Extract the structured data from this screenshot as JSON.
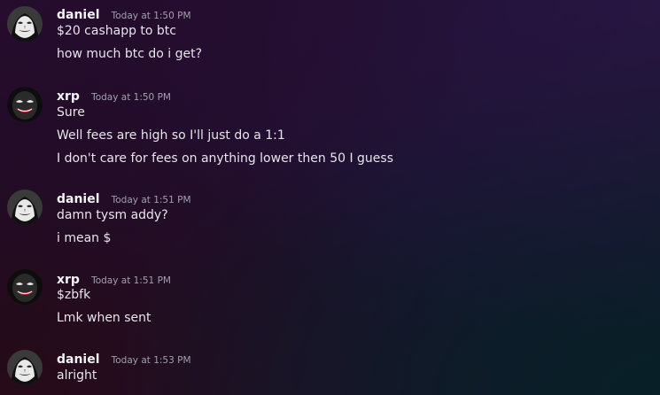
{
  "messages": [
    {
      "author": "daniel",
      "avatar_icon": "anonymous-mask-avatar-icon",
      "timestamp": "Today at 1:50 PM",
      "lines": [
        "$20 cashapp to btc",
        "how much btc do i get?"
      ]
    },
    {
      "author": "xrp",
      "avatar_icon": "joker-avatar-icon",
      "timestamp": "Today at 1:50 PM",
      "lines": [
        "Sure",
        "Well fees are high so I'll just do a 1:1",
        "I don't care for fees on anything lower then 50 I guess"
      ]
    },
    {
      "author": "daniel",
      "avatar_icon": "anonymous-mask-avatar-icon",
      "timestamp": "Today at 1:51 PM",
      "lines": [
        "damn tysm addy?",
        "i mean $"
      ]
    },
    {
      "author": "xrp",
      "avatar_icon": "joker-avatar-icon",
      "timestamp": "Today at 1:51 PM",
      "lines": [
        "$zbfk",
        "Lmk when sent"
      ]
    },
    {
      "author": "daniel",
      "avatar_icon": "anonymous-mask-avatar-icon",
      "timestamp": "Today at 1:53 PM",
      "lines": [
        "alright"
      ]
    }
  ]
}
